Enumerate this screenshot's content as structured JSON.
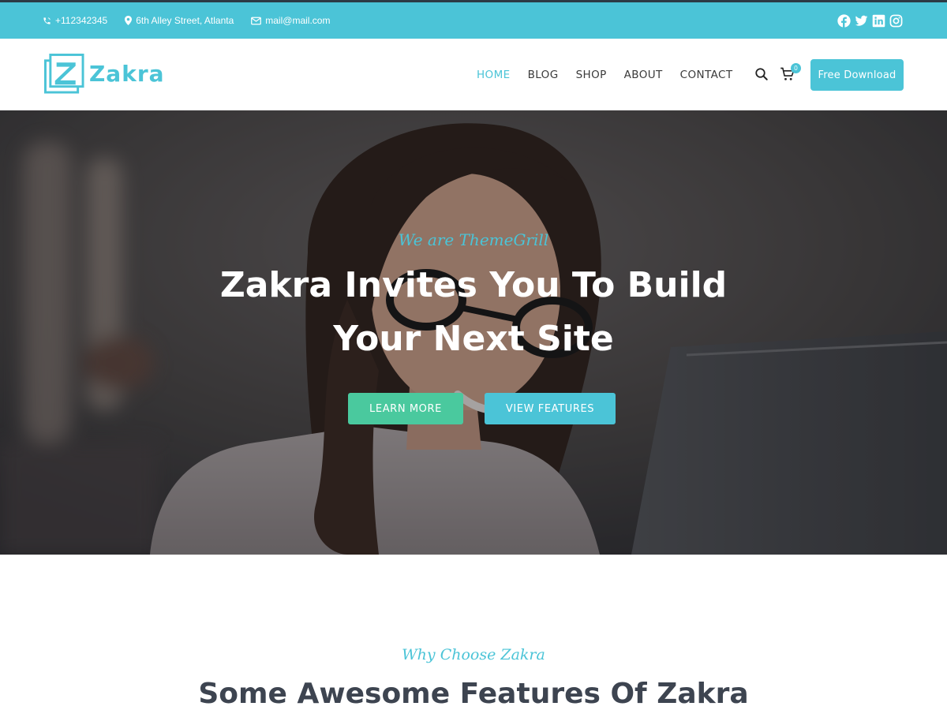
{
  "colors": {
    "accent": "#4bc4d7",
    "learn_button": "#4ac99e",
    "topbar_border": "#2c3b45",
    "heading": "#3d4450"
  },
  "topbar": {
    "phone": "+112342345",
    "phone_icon": "phone-icon",
    "address": "6th Alley Street, Atlanta",
    "address_icon": "map-marker-icon",
    "email": "mail@mail.com",
    "email_icon": "envelope-icon",
    "social": [
      "facebook-icon",
      "twitter-icon",
      "linkedin-icon",
      "instagram-icon"
    ]
  },
  "header": {
    "logo_text": "Zakra",
    "nav": [
      {
        "label": "HOME",
        "active": true
      },
      {
        "label": "BLOG",
        "active": false
      },
      {
        "label": "SHOP",
        "active": false
      },
      {
        "label": "ABOUT",
        "active": false
      },
      {
        "label": "CONTACT",
        "active": false
      }
    ],
    "search_icon": "search-icon",
    "cart_icon": "cart-icon",
    "cart_count": "0",
    "cta_label": "Free Download"
  },
  "hero": {
    "tagline": "We are ThemeGrill",
    "title": "Zakra Invites You To Build Your Next Site",
    "primary_button": "LEARN MORE",
    "secondary_button": "VIEW FEATURES"
  },
  "features": {
    "tagline": "Why Choose Zakra",
    "title": "Some Awesome Features Of Zakra"
  }
}
